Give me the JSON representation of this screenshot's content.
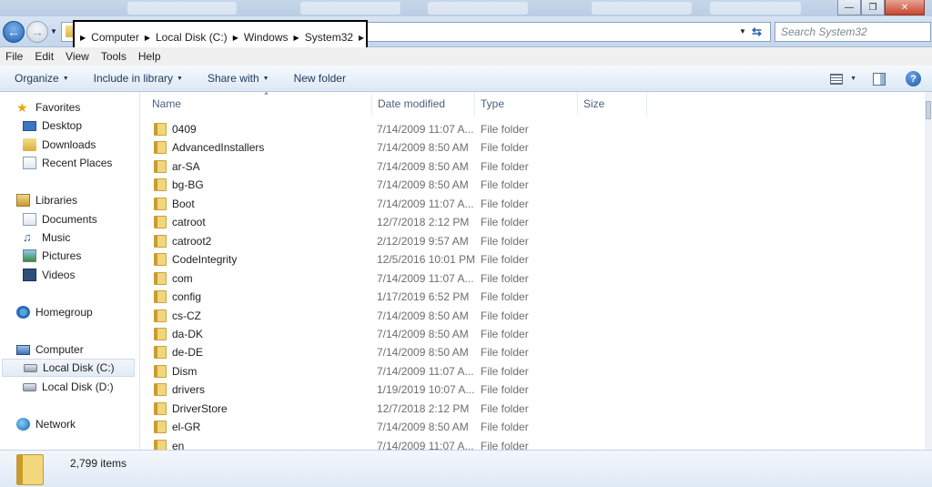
{
  "window": {
    "min": "0",
    "restore": "1",
    "close": "r"
  },
  "nav": {
    "breadcrumbs": [
      "Computer",
      "Local Disk (C:)",
      "Windows",
      "System32"
    ],
    "search_placeholder": "Search System32"
  },
  "menu": [
    "File",
    "Edit",
    "View",
    "Tools",
    "Help"
  ],
  "toolbar": {
    "organize": "Organize",
    "include": "Include in library",
    "share": "Share with",
    "new_folder": "New folder",
    "help": "?"
  },
  "sidebar": {
    "favorites": "Favorites",
    "desktop": "Desktop",
    "downloads": "Downloads",
    "recent": "Recent Places",
    "libraries": "Libraries",
    "documents": "Documents",
    "music": "Music",
    "pictures": "Pictures",
    "videos": "Videos",
    "homegroup": "Homegroup",
    "computer": "Computer",
    "disk_c": "Local Disk (C:)",
    "disk_d": "Local Disk (D:)",
    "network": "Network"
  },
  "columns": {
    "name": "Name",
    "date": "Date modified",
    "type": "Type",
    "size": "Size"
  },
  "files": [
    {
      "name": "0409",
      "date": "7/14/2009 11:07 A...",
      "type": "File folder"
    },
    {
      "name": "AdvancedInstallers",
      "date": "7/14/2009 8:50 AM",
      "type": "File folder"
    },
    {
      "name": "ar-SA",
      "date": "7/14/2009 8:50 AM",
      "type": "File folder"
    },
    {
      "name": "bg-BG",
      "date": "7/14/2009 8:50 AM",
      "type": "File folder"
    },
    {
      "name": "Boot",
      "date": "7/14/2009 11:07 A...",
      "type": "File folder"
    },
    {
      "name": "catroot",
      "date": "12/7/2018 2:12 PM",
      "type": "File folder"
    },
    {
      "name": "catroot2",
      "date": "2/12/2019 9:57 AM",
      "type": "File folder"
    },
    {
      "name": "CodeIntegrity",
      "date": "12/5/2016 10:01 PM",
      "type": "File folder"
    },
    {
      "name": "com",
      "date": "7/14/2009 11:07 A...",
      "type": "File folder"
    },
    {
      "name": "config",
      "date": "1/17/2019 6:52 PM",
      "type": "File folder"
    },
    {
      "name": "cs-CZ",
      "date": "7/14/2009 8:50 AM",
      "type": "File folder"
    },
    {
      "name": "da-DK",
      "date": "7/14/2009 8:50 AM",
      "type": "File folder"
    },
    {
      "name": "de-DE",
      "date": "7/14/2009 8:50 AM",
      "type": "File folder"
    },
    {
      "name": "Dism",
      "date": "7/14/2009 11:07 A...",
      "type": "File folder"
    },
    {
      "name": "drivers",
      "date": "1/19/2019 10:07 A...",
      "type": "File folder"
    },
    {
      "name": "DriverStore",
      "date": "12/7/2018 2:12 PM",
      "type": "File folder"
    },
    {
      "name": "el-GR",
      "date": "7/14/2009 8:50 AM",
      "type": "File folder"
    },
    {
      "name": "en",
      "date": "7/14/2009 11:07 A...",
      "type": "File folder"
    }
  ],
  "status": {
    "item_count": "2,799 items"
  }
}
